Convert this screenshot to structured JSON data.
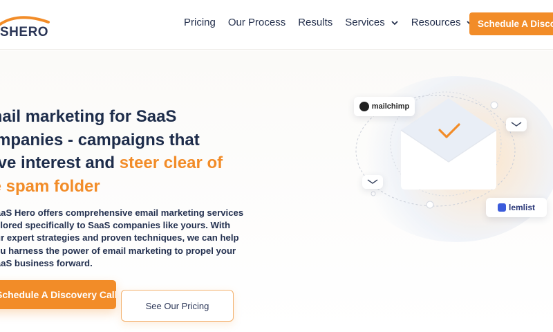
{
  "header": {
    "logo_text": "SHERO",
    "nav": [
      {
        "label": "Pricing",
        "has_dropdown": false
      },
      {
        "label": "Our Process",
        "has_dropdown": false
      },
      {
        "label": "Results",
        "has_dropdown": false
      },
      {
        "label": "Services",
        "has_dropdown": true
      },
      {
        "label": "Resources",
        "has_dropdown": true
      }
    ],
    "cta_label": "Schedule A Discovery Call"
  },
  "hero": {
    "headline_line1": "Email marketing for SaaS",
    "headline_line2": "companies - campaigns that",
    "headline_line3_a": "drive interest and ",
    "headline_line3_b": "steer clear of",
    "headline_line4": "the spam folder",
    "description": "SaaS Hero offers comprehensive email marketing services tailored specifically to SaaS companies like yours. With our expert strategies and proven techniques, we can help you harness the power of email marketing to propel your SaaS business forward.",
    "primary_button": "Schedule A Discovery Call",
    "secondary_button": "See Our Pricing"
  },
  "illustration": {
    "mailchimp_label": "mailchimp",
    "lemlist_label": "lemlist"
  },
  "colors": {
    "accent": "#f28c28",
    "text": "#1e2a44"
  }
}
